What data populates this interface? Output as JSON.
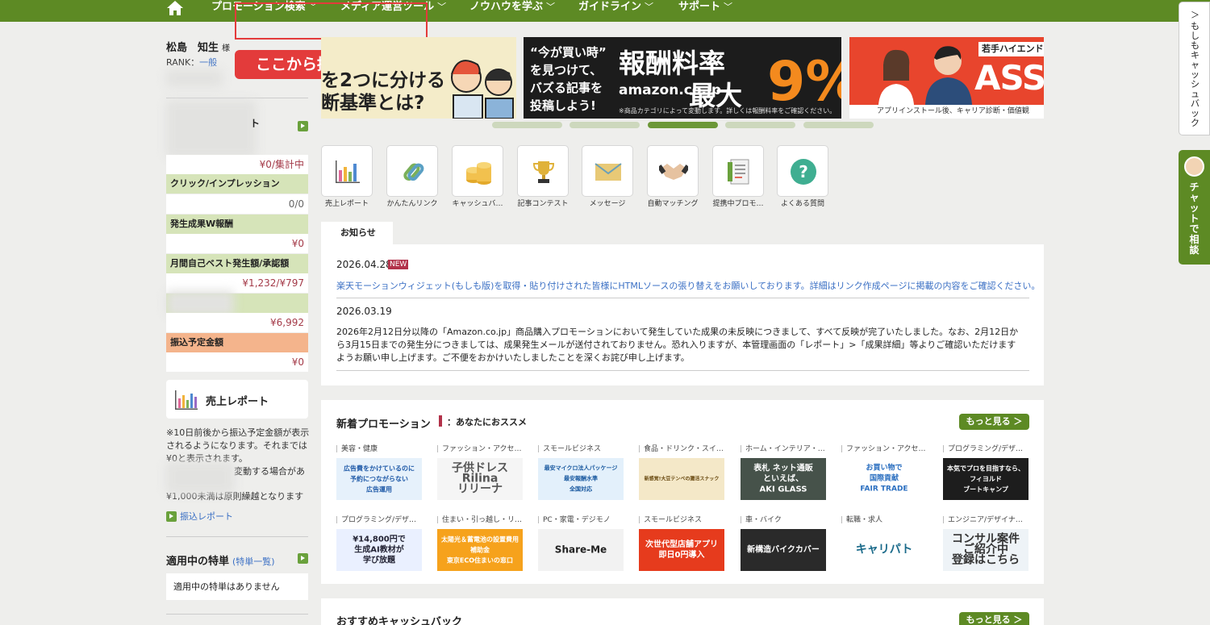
{
  "nav": {
    "items": [
      "プロモーション検索",
      "メディア運営ツール",
      "ノウハウを学ぶ",
      "ガイドライン",
      "サポート"
    ]
  },
  "callout": "ここから提携申請を進める",
  "user": {
    "name": "松島　知生",
    "honorific": "様",
    "rank_label": "RANK：",
    "rank_value": "一般"
  },
  "sidebar": {
    "blurred_heading_tail": "ト",
    "value_aggregating": "¥0/集計中",
    "click_label": "クリック/インプレッション",
    "click_value": "0/0",
    "w_reward_label": "発生成果W報酬",
    "w_reward_value": "¥0",
    "best_label": "月間自己ベスト発生額/承認額",
    "best_value": "¥1,232/¥797",
    "blurred_value": "¥6,992",
    "transfer_label": "振込予定金額",
    "transfer_value": "¥0",
    "report_button": "売上レポート",
    "note_line1": "※10日前後から振込予定金額が表示",
    "note_line2": "されるようになります。それまでは",
    "note_line3": "¥0と表示されます。",
    "note_line4": "変動する場合があ",
    "note_line5": "¥1,000未満は原則繰越となります",
    "transfer_report_link": "振込レポート",
    "special_title": "適用中の特単",
    "special_link": "(特単一覧)",
    "special_empty": "適用中の特単はありません"
  },
  "banners": {
    "b1_line1": "を2つに分ける",
    "b1_line2": "断基準とは?",
    "b2_q1": "“今が買い時”",
    "b2_q2": "を見つけて、",
    "b2_q3": "バズる記事を",
    "b2_q4": "投稿しよう!",
    "b2_big1": "報酬料率",
    "b2_amazon": "amazon.co.jp",
    "b2_big2": "最大",
    "b2_pct": "9%",
    "b2_fine": "※商品カテゴリによって変動します。詳しくは報酬料率をご確認ください。",
    "b3_tag": "若手ハイエンド",
    "b3_big": "ASS",
    "b3_foot": "アプリインストール後、キャリア診断・価値観"
  },
  "tools": [
    {
      "label": "売上レポート",
      "icon": "chart-icon"
    },
    {
      "label": "かんたんリンク",
      "icon": "link-icon"
    },
    {
      "label": "キャッシュバ…",
      "icon": "coins-icon"
    },
    {
      "label": "記事コンテスト",
      "icon": "trophy-icon"
    },
    {
      "label": "メッセージ",
      "icon": "envelope-icon"
    },
    {
      "label": "自動マッチング",
      "icon": "handshake-icon"
    },
    {
      "label": "提携中プロモ…",
      "icon": "document-icon"
    },
    {
      "label": "よくある質問",
      "icon": "question-icon"
    }
  ],
  "news": {
    "tab": "お知らせ",
    "items": [
      {
        "date": "2026.04.28",
        "badge": "NEW",
        "text": "楽天モーションウィジェット(もしも版)を取得・貼り付けされた皆様にHTMLソースの張り替えをお願いしております。詳細はリンク作成ページに掲載の内容をご確認ください。"
      },
      {
        "date": "2026.03.19",
        "text": "2026年2月12日分以降の「Amazon.co.jp」商品購入プロモーションにおいて発生していた成果の未反映につきまして、すべて反映が完了いたしました。なお、2月12日から3月15日までの発生分につきましては、成果発生メールが送付されておりません。恐れ入りますが、本管理画面の「レポート」>「成果詳細」等よりご確認いただけますようお願い申し上げます。ご不便をおかけいたしましたことを深くお詫び申し上げます。"
      }
    ]
  },
  "promotions": {
    "title": "新着プロモーション",
    "recommend": "：あなたにおススメ",
    "more": "もっと見る ＞",
    "items": [
      {
        "cat": "美容・健康",
        "text": "広告費をかけているのに\n予約につながらない\n広告運用",
        "bg": "#e6f1fb",
        "fg": "#1f5aa8"
      },
      {
        "cat": "ファッション・アクセ…",
        "text": "子供ドレス\nRilina\nリリーナ",
        "bg": "#f5f5f5",
        "fg": "#555"
      },
      {
        "cat": "スモールビジネス",
        "text": "最安マイクロ法人パッケージ\n最安報酬水準\n全国対応",
        "bg": "#e3f0fb",
        "fg": "#1b5aa0"
      },
      {
        "cat": "食品・ドリンク・スイ…",
        "text": "新感覚!大豆テンペの腸活スナック",
        "bg": "#f4e8c8",
        "fg": "#6a4b12"
      },
      {
        "cat": "ホーム・インテリア・…",
        "text": "表札 ネット通販\nといえば、\nAKI GLASS",
        "bg": "#46524a",
        "fg": "#fff"
      },
      {
        "cat": "ファッション・アクセ…",
        "text": "お買い物で\n国際貢献\nFAIR TRADE",
        "bg": "#fff",
        "fg": "#2b6fc0"
      },
      {
        "cat": "プログラミング/デザ…",
        "text": "本気でプロを目指すなら、\nフィヨルド\nブートキャンプ",
        "bg": "#1d1d1d",
        "fg": "#fff"
      },
      {
        "cat": "プログラミング/デザ…",
        "text": "¥14,800円で\n生成AI教材が\n学び放題",
        "bg": "#eaf0ff",
        "fg": "#223"
      },
      {
        "cat": "住まい・引っ越し・リ…",
        "text": "太陽光＆蓄電池の設置費用\n補助金\n東京ECO住まいの窓口",
        "bg": "#f6a21c",
        "fg": "#fff"
      },
      {
        "cat": "PC・家電・デジモノ",
        "text": "Share-Me",
        "bg": "#f2f2f2",
        "fg": "#222"
      },
      {
        "cat": "スモールビジネス",
        "text": "次世代型店舗アプリ\n即日0円導入",
        "bg": "#e63b1d",
        "fg": "#fff"
      },
      {
        "cat": "車・バイク",
        "text": "新構造バイクカバー",
        "bg": "#2a2a2a",
        "fg": "#fff"
      },
      {
        "cat": "転職・求人",
        "text": "キャリパト",
        "bg": "#fff",
        "fg": "#1a6a8a"
      },
      {
        "cat": "エンジニア/デザイナ…",
        "text": "コンサル案件\nご紹介中\n登録はこちら",
        "bg": "#eef3f7",
        "fg": "#333"
      }
    ]
  },
  "cashback": {
    "title": "おすすめキャッシュバック",
    "more": "もっと見る ＞"
  },
  "right_tabs": {
    "cashback": "もしもキャッシュバック",
    "chat": "チャットで相談"
  },
  "colors": {
    "brand_green": "#5d8a24",
    "accent_red": "#e33b3b",
    "value_red": "#a43a48",
    "link_blue": "#3a6fc4"
  }
}
